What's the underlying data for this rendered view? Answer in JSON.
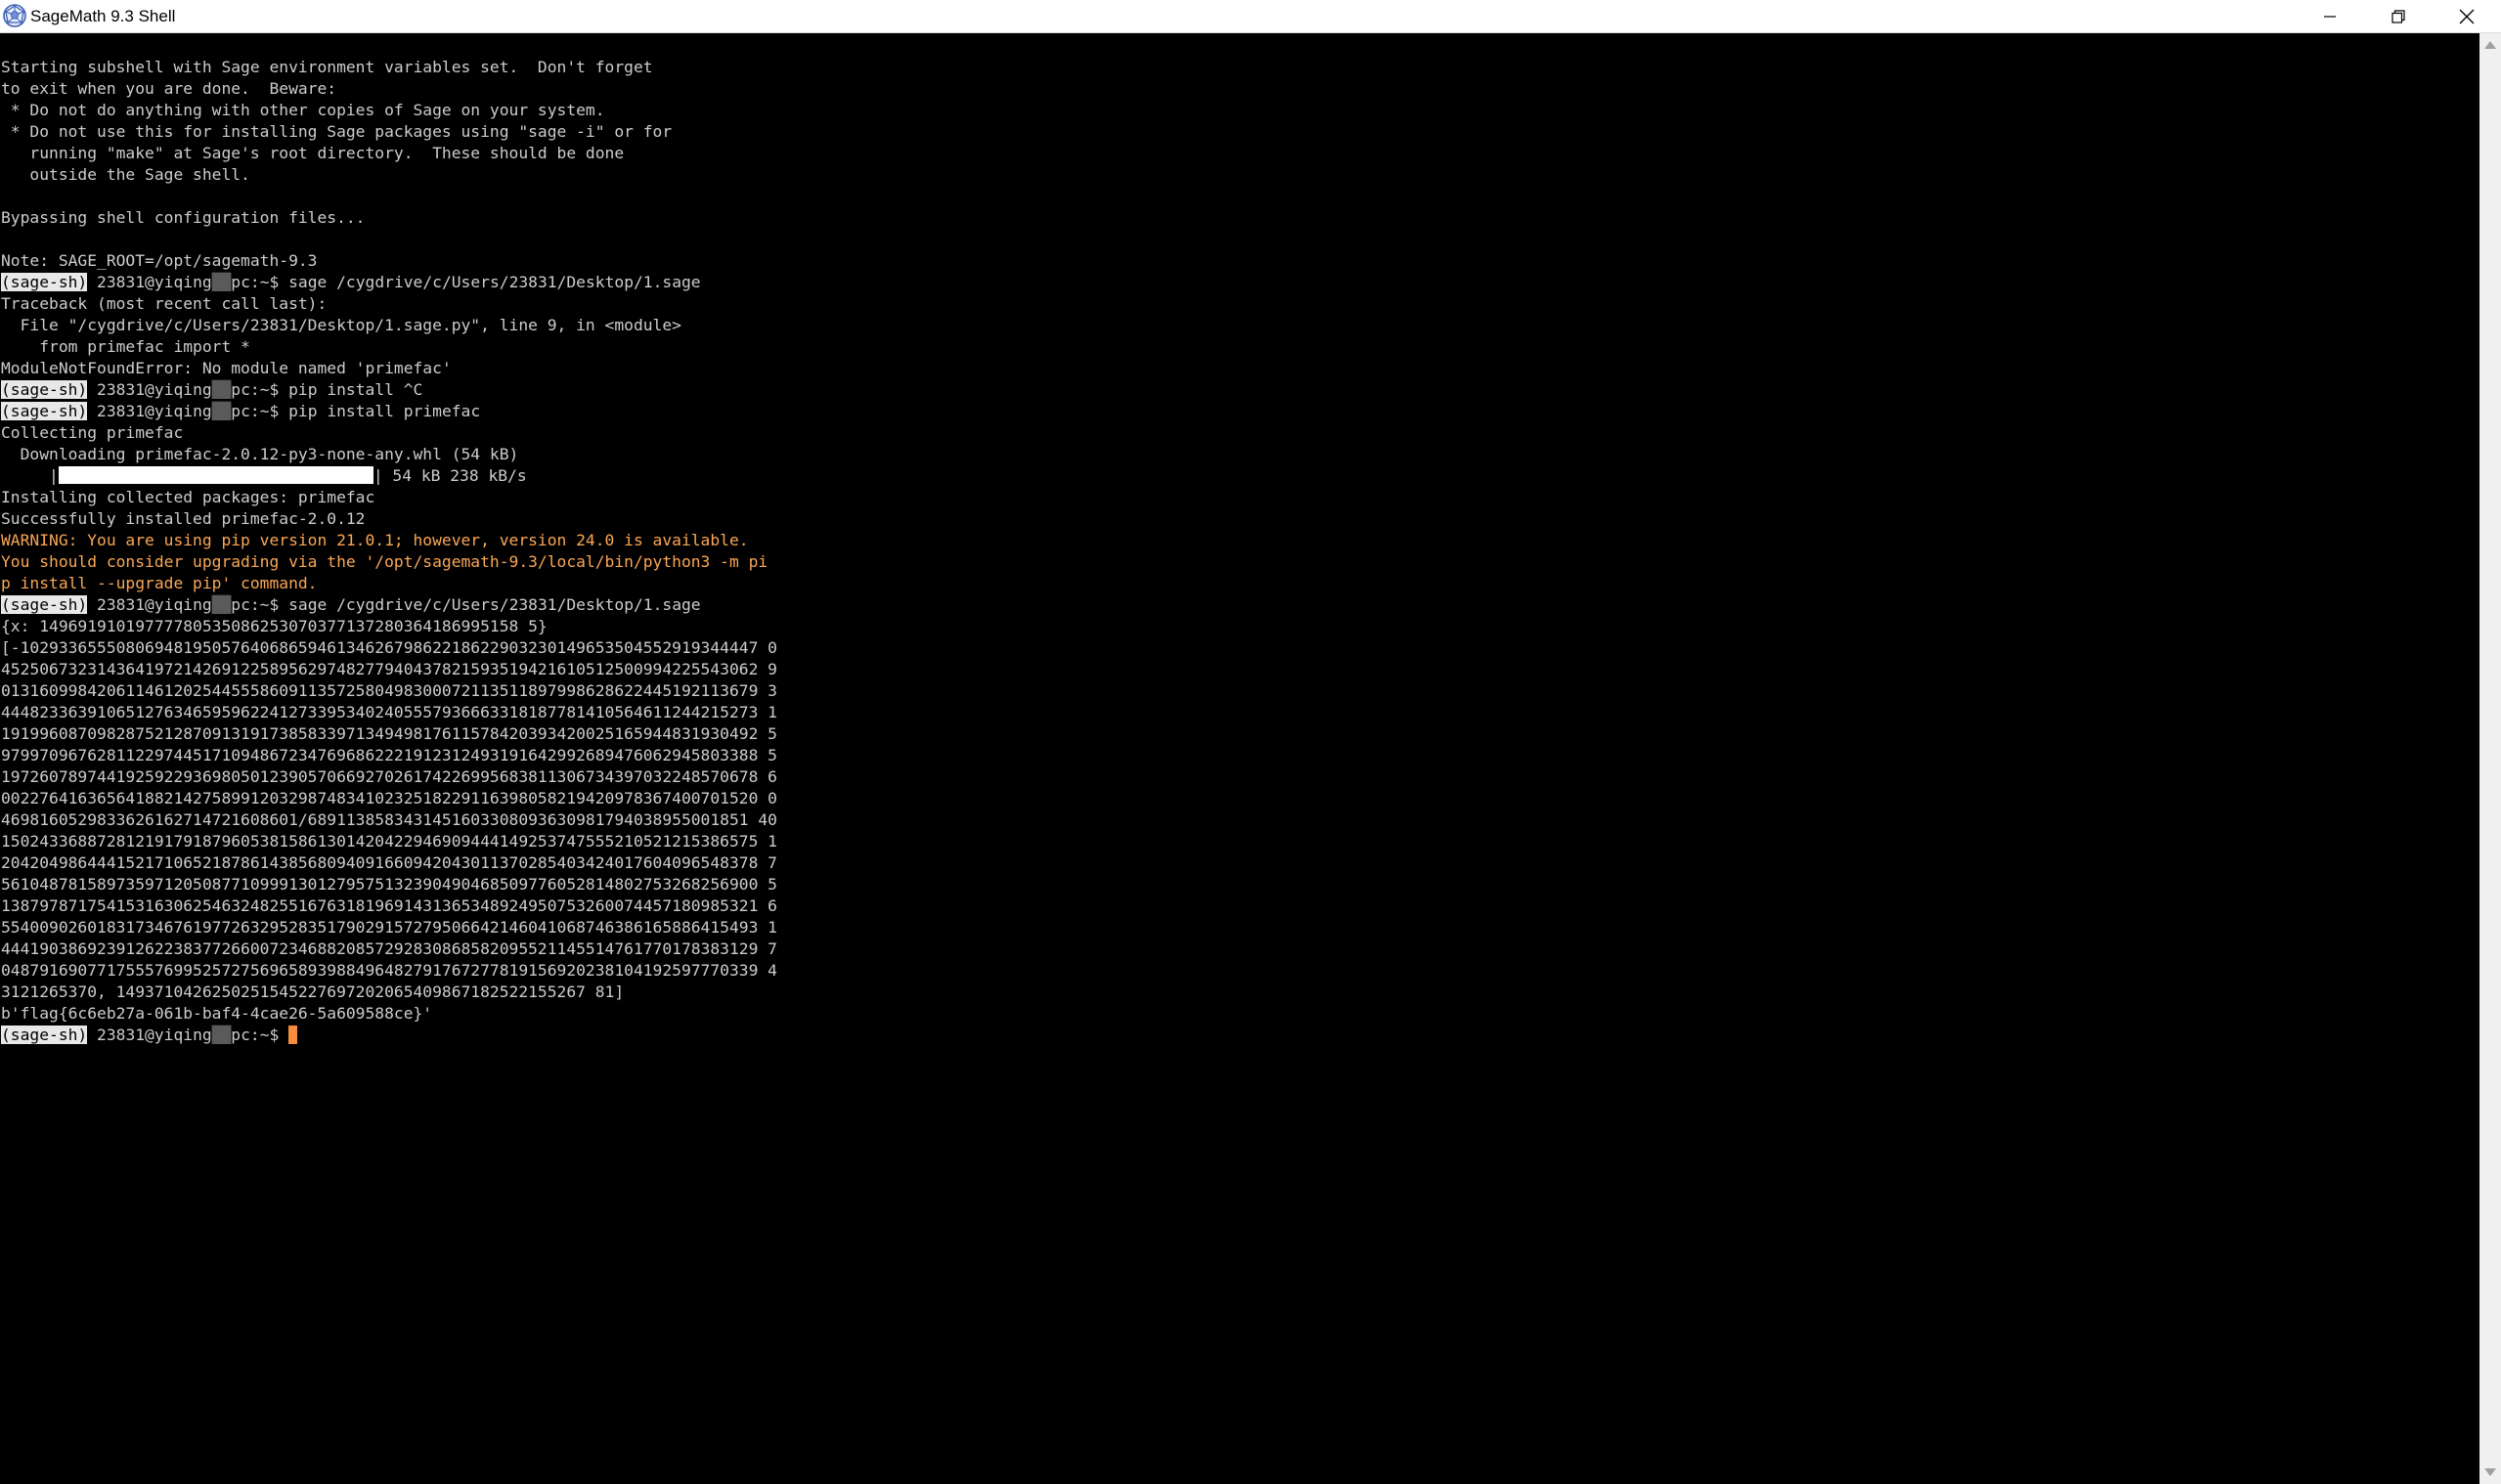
{
  "window": {
    "title": "SageMath 9.3 Shell"
  },
  "prompt": {
    "tag": "(sage-sh)",
    "user_a": "23831@yiqing",
    "user_b": "pc:~$"
  },
  "lines": [
    "Starting subshell with Sage environment variables set.  Don't forget",
    "to exit when you are done.  Beware:",
    " * Do not do anything with other copies of Sage on your system.",
    " * Do not use this for installing Sage packages using \"sage -i\" or for",
    "   running \"make\" at Sage's root directory.  These should be done",
    "   outside the Sage shell.",
    "",
    "Bypassing shell configuration files...",
    "",
    "Note: SAGE_ROOT=/opt/sagemath-9.3"
  ],
  "cmd1": " sage /cygdrive/c/Users/23831/Desktop/1.sage",
  "traceback": [
    "Traceback (most recent call last):",
    "  File \"/cygdrive/c/Users/23831/Desktop/1.sage.py\", line 9, in <module>",
    "    from primefac import *",
    "ModuleNotFoundError: No module named 'primefac'"
  ],
  "cmd2": " pip install ^C",
  "cmd3": " pip install primefac",
  "install": {
    "collecting": "Collecting primefac",
    "downloading": "  Downloading primefac-2.0.12-py3-none-any.whl (54 kB)",
    "bar_prefix": "     |",
    "bar_suffix": "| 54 kB 238 kB/s",
    "progress_fraction": 1.0,
    "installing": "Installing collected packages: primefac",
    "success": "Successfully installed primefac-2.0.12"
  },
  "warning": [
    "WARNING: You are using pip version 21.0.1; however, version 24.0 is available.",
    "You should consider upgrading via the '/opt/sagemath-9.3/local/bin/python3 -m pi",
    "p install --upgrade pip' command."
  ],
  "cmd4": " sage /cygdrive/c/Users/23831/Desktop/1.sage",
  "output": [
    "{x: 14969191019777780535086253070377137280364186995158 5}",
    "[-10293365550806948195057640686594613462679862218622903230149653504552919344447 0",
    "4525067323143641972142691225895629748277940437821593519421610512500994225543062 9",
    "0131609984206114612025445558609113572580498300072113511897998628622445192113679 3",
    "4448233639106512763465959622412733953402405557936663318187781410564611244215273 1",
    "1919960870982875212870913191738583397134949817611578420393420025165944831930492 5",
    "9799709676281122974451710948672347696862221912312493191642992689476062945803388 5",
    "1972607897441925922936980501239057066927026174226995683811306734397032248570678 6",
    "0022764163656418821427589912032987483410232518229116398058219420978367400701520 0",
    "4698160529833626162714721608601/6891138583431451603308093630981794038955001851 40",
    "1502433688728121917918796053815861301420422946909444149253747555210521215386575 1",
    "2042049864441521710652187861438568094091660942043011370285403424017604096548378 7",
    "5610487815897359712050877109991301279575132390490468509776052814802753268256900 5",
    "1387978717541531630625463248255167631819691431365348924950753260074457180985321 6",
    "5540090260183173467619772632952835179029157279506642146041068746386165886415493 1",
    "4441903869239126223837726600723468820857292830868582095521145514761770178383129 7",
    "0487916907717555769952572756965893988496482791767277819156920238104192597770339 4",
    "3121265370, 1493710426250251545227697202065409867182522155267 81]",
    "b'flag{6c6eb27a-061b-baf4-4cae26-5a609588ce}'"
  ]
}
